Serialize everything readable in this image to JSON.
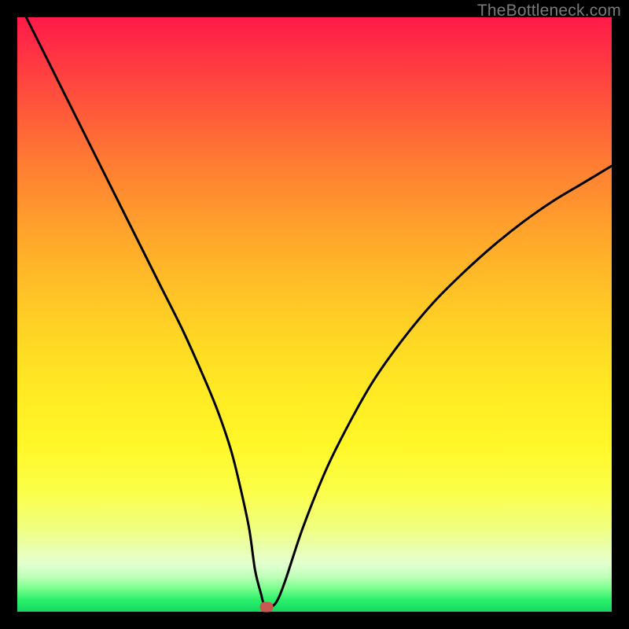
{
  "watermark": "TheBottleneck.com",
  "chart_data": {
    "type": "line",
    "title": "",
    "xlabel": "",
    "ylabel": "",
    "xlim": [
      0,
      100
    ],
    "ylim": [
      0,
      100
    ],
    "grid": false,
    "series": [
      {
        "name": "curve",
        "x": [
          0,
          4,
          8,
          12,
          16,
          20,
          24,
          28,
          32,
          34,
          36,
          37.5,
          39,
          40,
          41,
          41.6,
          42.2,
          43.5,
          45,
          48,
          52,
          56,
          60,
          65,
          70,
          75,
          80,
          85,
          90,
          95,
          100
        ],
        "values": [
          103,
          95,
          87,
          79,
          71,
          63,
          55,
          47,
          38,
          33,
          27,
          21,
          14,
          7,
          3,
          0.8,
          0.7,
          1.5,
          5,
          14,
          24,
          32,
          39,
          46,
          52,
          57,
          61.5,
          65.5,
          69,
          72,
          75
        ]
      }
    ],
    "marker": {
      "x": 41.9,
      "y": 0.8,
      "color": "#c65a52"
    },
    "background_gradient": {
      "top": "#ff1a49",
      "mid": "#ffec24",
      "bottom": "#13d85f"
    },
    "curve_style": {
      "stroke": "#000000",
      "width": 3
    }
  }
}
